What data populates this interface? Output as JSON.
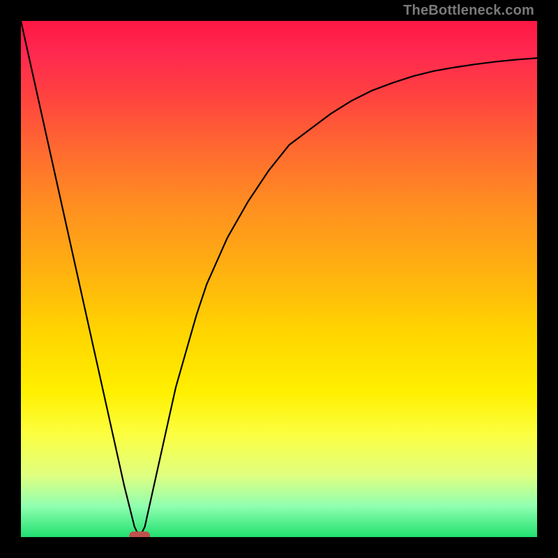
{
  "watermark": "TheBottleneck.com",
  "chart_data": {
    "type": "line",
    "title": "",
    "xlabel": "",
    "ylabel": "",
    "xlim": [
      0,
      100
    ],
    "ylim": [
      0,
      100
    ],
    "grid": false,
    "legend": false,
    "series": [
      {
        "name": "bottleneck-curve",
        "x": [
          0,
          2,
          4,
          6,
          8,
          10,
          12,
          14,
          16,
          18,
          20,
          22,
          23,
          24,
          26,
          28,
          30,
          32,
          34,
          36,
          40,
          44,
          48,
          52,
          56,
          60,
          64,
          68,
          72,
          76,
          80,
          84,
          88,
          92,
          96,
          100
        ],
        "y": [
          100,
          91,
          82,
          73,
          64,
          55,
          46,
          37,
          28,
          19,
          10,
          2,
          0,
          2,
          11,
          20,
          29,
          36,
          43,
          49,
          58,
          65,
          71,
          76,
          79,
          82,
          84.5,
          86.5,
          88,
          89.3,
          90.3,
          91,
          91.6,
          92.1,
          92.5,
          92.8
        ]
      }
    ],
    "annotations": [
      {
        "name": "optimum-marker",
        "shape": "pill",
        "x": 23,
        "y": 0,
        "color": "#c0524e"
      }
    ],
    "background_gradient": {
      "direction": "vertical",
      "stops": [
        {
          "pos": 0.0,
          "color": "#ff1744"
        },
        {
          "pos": 0.25,
          "color": "#ff6a30"
        },
        {
          "pos": 0.6,
          "color": "#ffd400"
        },
        {
          "pos": 0.8,
          "color": "#fcff40"
        },
        {
          "pos": 1.0,
          "color": "#20e070"
        }
      ]
    }
  }
}
